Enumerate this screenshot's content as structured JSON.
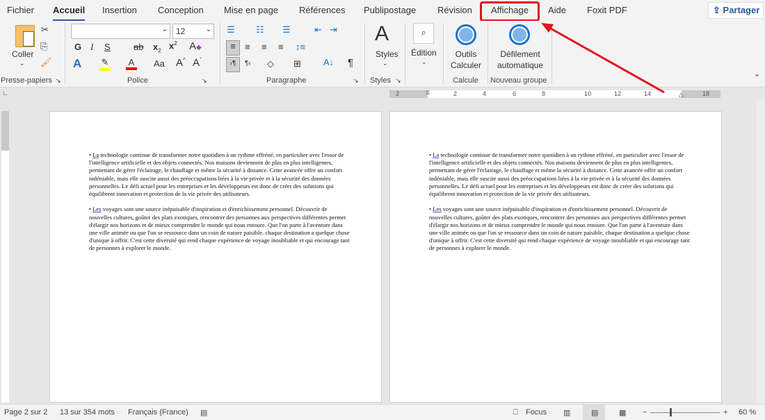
{
  "tabs": [
    "Fichier",
    "Accueil",
    "Insertion",
    "Conception",
    "Mise en page",
    "Références",
    "Publipostage",
    "Révision",
    "Affichage",
    "Aide",
    "Foxit PDF"
  ],
  "active_tab": "Accueil",
  "share_label": "Partager",
  "ribbon": {
    "clipboard": {
      "paste": "Coller",
      "label": "Presse-papiers"
    },
    "font": {
      "name": "",
      "size": "12",
      "label": "Police",
      "bold": "G",
      "italic": "I",
      "underline": "S",
      "strike": "ab",
      "case": "Aa"
    },
    "paragraph": {
      "label": "Paragraphe"
    },
    "styles": {
      "button": "Styles",
      "label": "Styles"
    },
    "editing": {
      "button": "Édition"
    },
    "calc": {
      "button_line1": "Outils",
      "button_line2": "Calculer",
      "label": "Calcule"
    },
    "newgroup": {
      "button_line1": "Défilement",
      "button_line2": "automatique",
      "label": "Nouveau groupe"
    }
  },
  "ruler": [
    "2",
    "2",
    "4",
    "6",
    "8",
    "10",
    "12",
    "14",
    "18"
  ],
  "pages": [
    {
      "paragraphs": [
        {
          "first": "La",
          "rest": " technologie continue de transformer notre quotidien à un rythme effréné, en particulier avec l'essor de l'intelligence artificielle et des objets connectés. Nos maisons deviennent de plus en plus intelligentes, permettant de gérer l'éclairage, le chauffage et même la sécurité à distance. Cette avancée offre un confort indéniable, mais elle suscite aussi des préoccupations liées à la vie privée et à la sécurité des données personnelles. Le défi actuel pour les entreprises et les développeurs est donc de créer des solutions qui équilibrent innovation et protection de la vie privée des utilisateurs."
        },
        {
          "first": "Les",
          "rest": " voyages sont une source inépuisable d'inspiration et d'enrichissement personnel. Découvrir de nouvelles cultures, goûter des plats exotiques, rencontrer des personnes aux perspectives différentes permet d'élargir nos horizons et de mieux comprendre le monde qui nous entoure. Que l'on parte à l'aventure dans une ville animée ou que l'on se ressource dans un coin de nature paisible, chaque destination a quelque chose d'unique à offrir. C'est cette diversité qui rend chaque expérience de voyage inoubliable et qui encourage tant de personnes à explorer le monde."
        }
      ]
    },
    {
      "paragraphs": [
        {
          "first": "La",
          "rest": " technologie continue de transformer notre quotidien à un rythme effréné, en particulier avec l'essor de l'intelligence artificielle et des objets connectés. Nos maisons deviennent de plus en plus intelligentes, permettant de gérer l'éclairage, le chauffage et même la sécurité à distance. Cette avancée offre un confort indéniable, mais elle suscite aussi des préoccupations liées à la vie privée et à la sécurité des données personnelles. Le défi actuel pour les entreprises et les développeurs est donc de créer des solutions qui équilibrent innovation et protection de la vie privée des utilisateurs."
        },
        {
          "first": "Les",
          "rest": " voyages sont une source inépuisable d'inspiration et d'enrichissement personnel. Découvrir de nouvelles cultures, goûter des plats exotiques, rencontrer des personnes aux perspectives différentes permet d'élargir nos horizons et de mieux comprendre le monde qui nous entoure. Que l'on parte à l'aventure dans une ville animée ou que l'on se ressource dans un coin de nature paisible, chaque destination a quelque chose d'unique à offrir. C'est cette diversité qui rend chaque expérience de voyage inoubliable et qui encourage tant de personnes à explorer le monde."
        }
      ]
    }
  ],
  "status": {
    "page": "Page 2 sur 2",
    "words": "13 sur 354 mots",
    "language": "Français (France)",
    "focus": "Focus",
    "zoom": "60 %",
    "zoom_percent": 60
  },
  "colors": {
    "accent": "#2b579a",
    "highlight_box": "#e0141e",
    "highlight_yellow": "#ffff00",
    "font_red": "#ff0000"
  }
}
